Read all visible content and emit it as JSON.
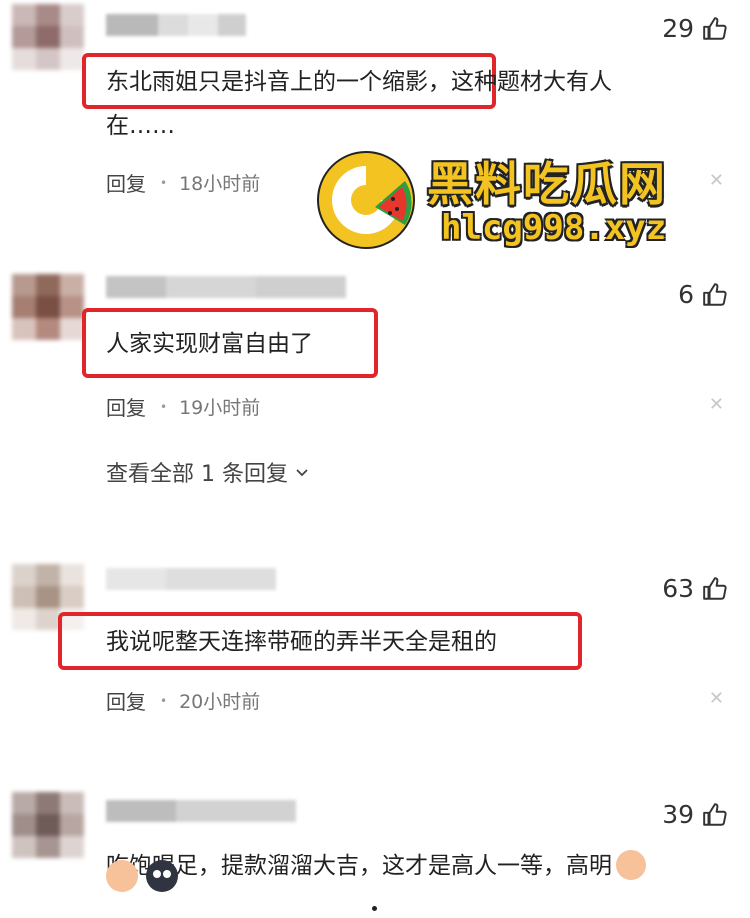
{
  "comments": [
    {
      "likes": "29",
      "text_line1": "东北雨姐只是抖音上的一个缩影，",
      "text_line1_cont": "这种题材大有人",
      "text_line2": "在……",
      "reply_label": "回复",
      "time": "18小时前"
    },
    {
      "likes": "6",
      "text": "人家实现财富自由了",
      "reply_label": "回复",
      "time": "19小时前",
      "view_replies": "查看全部 1 条回复"
    },
    {
      "likes": "63",
      "text": "我说呢整天连摔带砸的弄半天全是租的",
      "reply_label": "回复",
      "time": "20小时前"
    },
    {
      "likes": "39",
      "text": "吃饱喝足，提款溜溜大吉，这才是高人一等，高明"
    }
  ],
  "watermark": {
    "title": "黑料吃瓜网",
    "url": "hlcg998.xyz"
  },
  "icons": {
    "like": "thumbs-up-icon",
    "close": "close-icon",
    "chevron": "chevron-down-icon"
  },
  "colors": {
    "highlight": "#e0262b",
    "watermark": "#f3c322"
  }
}
